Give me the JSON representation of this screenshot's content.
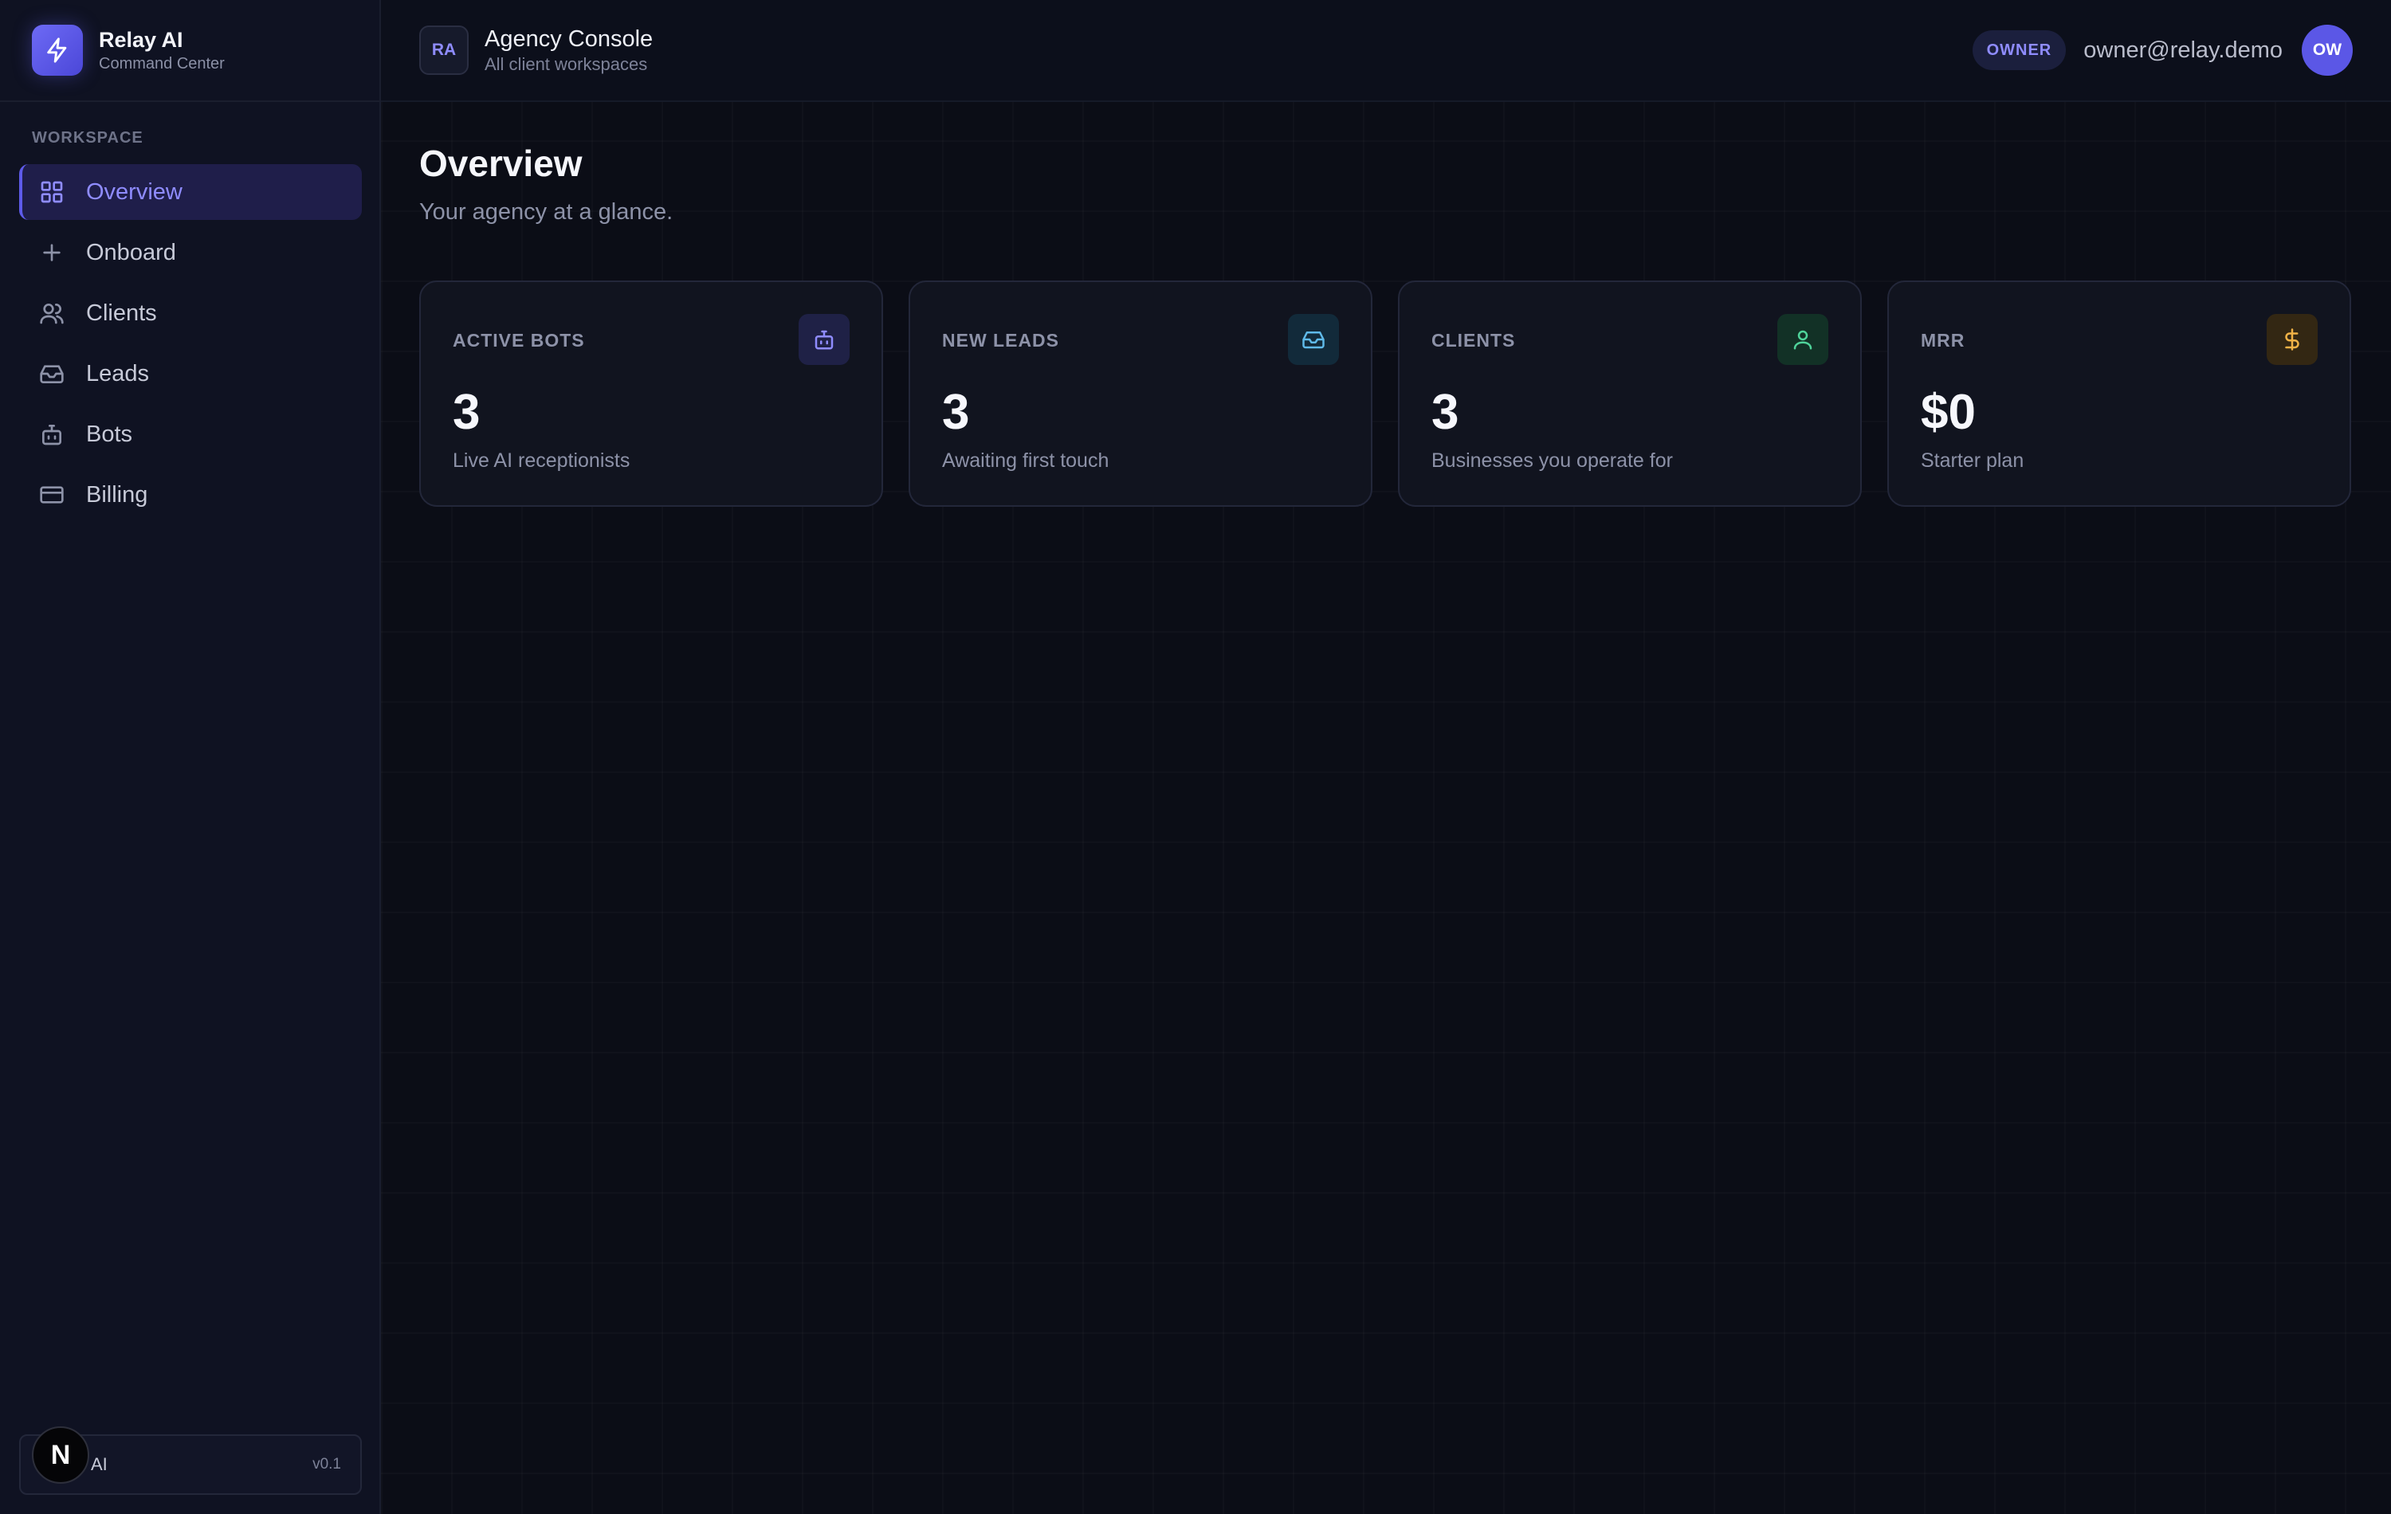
{
  "brand": {
    "name": "Relay AI",
    "subtitle": "Command Center"
  },
  "sidebar": {
    "section_label": "WORKSPACE",
    "items": [
      {
        "label": "Overview",
        "icon": "grid-icon",
        "active": true
      },
      {
        "label": "Onboard",
        "icon": "plus-icon"
      },
      {
        "label": "Clients",
        "icon": "users-icon"
      },
      {
        "label": "Leads",
        "icon": "inbox-icon"
      },
      {
        "label": "Bots",
        "icon": "bot-icon"
      },
      {
        "label": "Billing",
        "icon": "credit-card-icon"
      }
    ],
    "footer": {
      "badge": "N",
      "name": "AI",
      "version": "v0.1"
    }
  },
  "topbar": {
    "workspace_initials": "RA",
    "title": "Agency Console",
    "subtitle": "All client workspaces",
    "role": "OWNER",
    "email": "owner@relay.demo",
    "avatar_initials": "OW"
  },
  "page": {
    "title": "Overview",
    "subtitle": "Your agency at a glance."
  },
  "cards": [
    {
      "label": "ACTIVE BOTS",
      "value": "3",
      "description": "Live AI receptionists",
      "icon": "bot-icon",
      "color": "#8f8cff"
    },
    {
      "label": "NEW LEADS",
      "value": "3",
      "description": "Awaiting first touch",
      "icon": "inbox-icon",
      "color": "#5fb9e8"
    },
    {
      "label": "CLIENTS",
      "value": "3",
      "description": "Businesses you operate for",
      "icon": "user-icon",
      "color": "#4fd39a"
    },
    {
      "label": "MRR",
      "value": "$0",
      "description": "Starter plan",
      "icon": "dollar-icon",
      "color": "#f0b246"
    }
  ]
}
